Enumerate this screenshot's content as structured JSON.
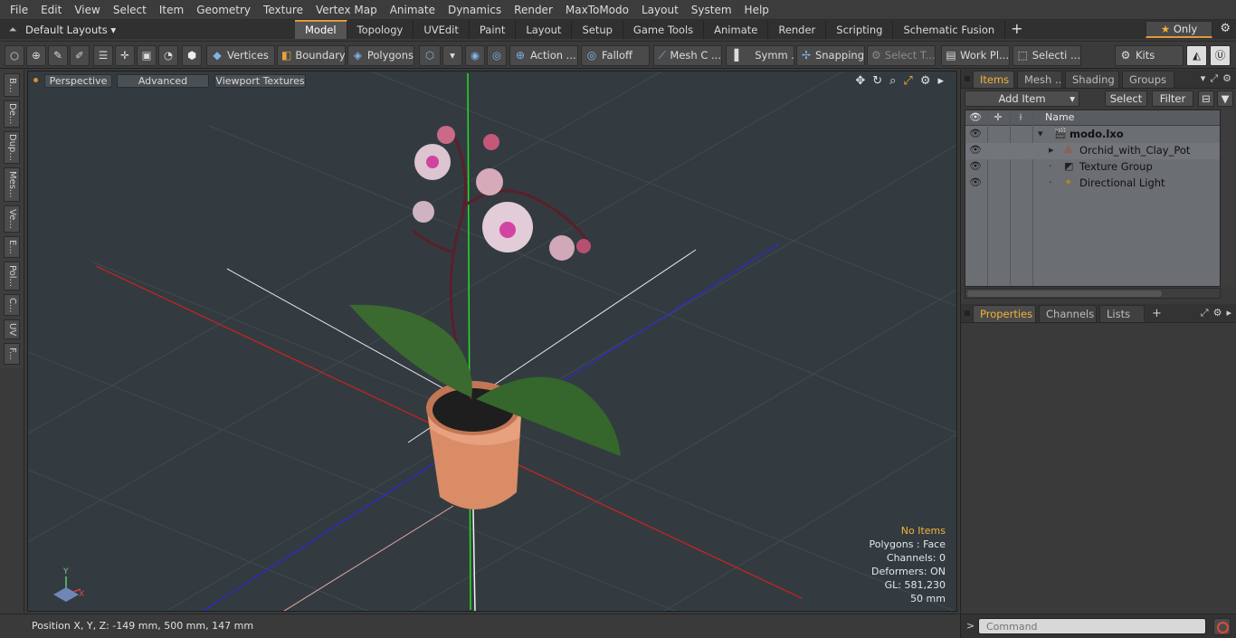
{
  "menu": [
    "File",
    "Edit",
    "View",
    "Select",
    "Item",
    "Geometry",
    "Texture",
    "Vertex Map",
    "Animate",
    "Dynamics",
    "Render",
    "MaxToModo",
    "Layout",
    "System",
    "Help"
  ],
  "layout": {
    "dropdown_label": "Default Layouts ▾"
  },
  "tabs": [
    {
      "label": "Model",
      "active": true
    },
    {
      "label": "Topology"
    },
    {
      "label": "UVEdit"
    },
    {
      "label": "Paint"
    },
    {
      "label": "Layout"
    },
    {
      "label": "Setup"
    },
    {
      "label": "Game Tools"
    },
    {
      "label": "Animate"
    },
    {
      "label": "Render"
    },
    {
      "label": "Scripting"
    },
    {
      "label": "Schematic Fusion"
    }
  ],
  "tab_add": "+",
  "only_label": "Only",
  "toolbar": {
    "vertices": "Vertices",
    "boundary": "Boundary",
    "polygons": "Polygons",
    "action": "Action ...",
    "falloff": "Falloff",
    "mesh_c": "Mesh C ...",
    "symm": "Symm ...",
    "snapping": "Snapping",
    "select_t": "Select T...",
    "work_pl": "Work Pl...",
    "selecti": "Selecti ...",
    "kits": "Kits"
  },
  "left_tabs": [
    "B...",
    "De...",
    "Dup...",
    "Mes...",
    "Ve...",
    "E...",
    "Pol...",
    "C...",
    "UV",
    "F..."
  ],
  "viewport": {
    "perspective": "Perspective",
    "advanced": "Advanced",
    "viewport_textures": "Viewport Textures",
    "info": {
      "selection": "No Items",
      "polygons": "Polygons : Face",
      "channels": "Channels: 0",
      "deformers": "Deformers: ON",
      "gl": "GL: 581,230",
      "scale": "50 mm"
    },
    "axis_labels": {
      "y": "Y",
      "x": "X"
    }
  },
  "status": {
    "position": "Position X, Y, Z:   -149 mm, 500 mm, 147 mm"
  },
  "items_panel": {
    "tabs": [
      {
        "label": "Items",
        "active": true
      },
      {
        "label": "Mesh ..."
      },
      {
        "label": "Shading"
      },
      {
        "label": "Groups"
      }
    ],
    "add_item": "Add Item",
    "select": "Select",
    "filter": "Filter",
    "name_header": "Name",
    "tree": [
      {
        "label": "modo.lxo",
        "depth": 0
      },
      {
        "label": "Orchid_with_Clay_Pot",
        "depth": 1
      },
      {
        "label": "Texture Group",
        "depth": 1
      },
      {
        "label": "Directional Light",
        "depth": 1
      }
    ]
  },
  "properties_panel": {
    "tabs": [
      {
        "label": "Properties",
        "active": true
      },
      {
        "label": "Channels"
      },
      {
        "label": "Lists"
      }
    ],
    "add": "+"
  },
  "command": {
    "placeholder": "Command"
  },
  "colors": {
    "accent": "#e09a3a",
    "viewport_bg": "#333b40",
    "axis_x": "#e02020",
    "axis_y": "#20e020",
    "axis_z": "#2020e0"
  }
}
